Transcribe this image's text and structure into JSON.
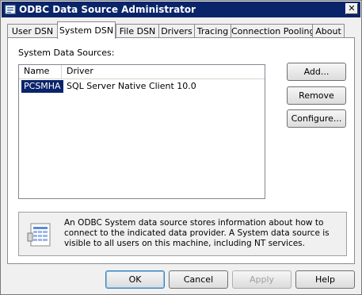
{
  "window": {
    "title": "ODBC Data Source Administrator",
    "close_glyph": "✕"
  },
  "tabs": [
    {
      "label": "User DSN",
      "active": false
    },
    {
      "label": "System DSN",
      "active": true
    },
    {
      "label": "File DSN",
      "active": false
    },
    {
      "label": "Drivers",
      "active": false
    },
    {
      "label": "Tracing",
      "active": false
    },
    {
      "label": "Connection Pooling",
      "active": false
    },
    {
      "label": "About",
      "active": false
    }
  ],
  "panel": {
    "section_label": "System Data Sources:",
    "columns": {
      "name": "Name",
      "driver": "Driver"
    },
    "rows": [
      {
        "name": "PCSMHA",
        "driver": "SQL Server Native Client 10.0",
        "selected": true
      }
    ],
    "buttons": {
      "add": "Add...",
      "remove": "Remove",
      "configure": "Configure..."
    },
    "info": "An ODBC System data source stores information about how to connect to the indicated data provider.   A System data source is visible to all users on this machine, including NT services."
  },
  "footer": {
    "ok": "OK",
    "cancel": "Cancel",
    "apply": "Apply",
    "apply_enabled": false,
    "help": "Help"
  },
  "colors": {
    "titlebar": "#0a246a",
    "selection": "#0a246a",
    "panel_bg": "#ffffff",
    "window_bg": "#f0f0f0"
  },
  "icons": {
    "title": "odbc-icon",
    "info": "data-source-icon"
  }
}
